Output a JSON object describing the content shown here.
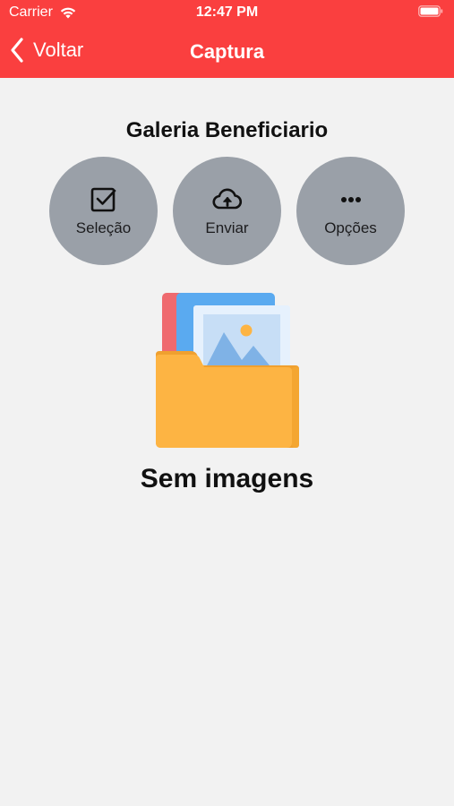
{
  "status_bar": {
    "carrier": "Carrier",
    "time": "12:47 PM",
    "wifi_icon": "wifi-icon",
    "battery_icon": "battery-icon"
  },
  "nav": {
    "back_label": "Voltar",
    "back_icon": "chevron-left-icon",
    "title": "Captura"
  },
  "gallery": {
    "title": "Galeria Beneficiario"
  },
  "actions": [
    {
      "label": "Seleção",
      "icon": "checkbox-icon"
    },
    {
      "label": "Enviar",
      "icon": "cloud-upload-icon"
    },
    {
      "label": "Opções",
      "icon": "ellipsis-icon"
    }
  ],
  "empty_state": {
    "illustration": "folder-images-icon",
    "message": "Sem imagens"
  },
  "colors": {
    "header": "#fa3f3f",
    "background": "#f2f2f2",
    "action_button": "#9aa0a8",
    "folder": "#fdb443",
    "text_dark": "#111111"
  }
}
